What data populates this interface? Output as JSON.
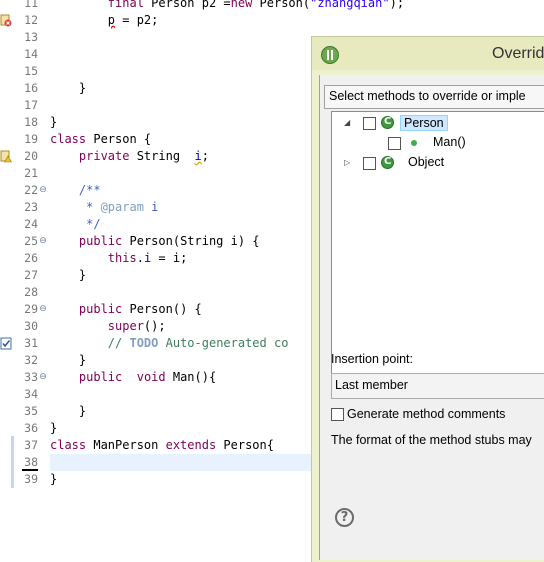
{
  "editor": {
    "lines": [
      {
        "num": "11",
        "code": "        final Person p2 =new Person(\"zhangqian\");"
      },
      {
        "num": "12",
        "code": "        p = p2;"
      },
      {
        "num": "13",
        "code": ""
      },
      {
        "num": "14",
        "code": ""
      },
      {
        "num": "15",
        "code": ""
      },
      {
        "num": "16",
        "code": "    }"
      },
      {
        "num": "17",
        "code": ""
      },
      {
        "num": "18",
        "code": "}"
      },
      {
        "num": "19",
        "code": "class Person {"
      },
      {
        "num": "20",
        "code": "    private String  i;"
      },
      {
        "num": "21",
        "code": ""
      },
      {
        "num": "22",
        "code": "    /**"
      },
      {
        "num": "23",
        "code": "     * @param i"
      },
      {
        "num": "24",
        "code": "     */"
      },
      {
        "num": "25",
        "code": "    public Person(String i) {"
      },
      {
        "num": "26",
        "code": "        this.i = i;"
      },
      {
        "num": "27",
        "code": "    }"
      },
      {
        "num": "28",
        "code": ""
      },
      {
        "num": "29",
        "code": "    public Person() {"
      },
      {
        "num": "30",
        "code": "        super();"
      },
      {
        "num": "31",
        "code": "        // TODO Auto-generated co"
      },
      {
        "num": "32",
        "code": "    }"
      },
      {
        "num": "33",
        "code": "    public  void Man(){"
      },
      {
        "num": "34",
        "code": ""
      },
      {
        "num": "35",
        "code": "    }"
      },
      {
        "num": "36",
        "code": "}"
      },
      {
        "num": "37",
        "code": "class ManPerson extends Person{"
      },
      {
        "num": "38",
        "code": ""
      },
      {
        "num": "39",
        "code": "}"
      }
    ]
  },
  "dialog": {
    "title": "Overrid",
    "select_label": "Select methods to override or imple",
    "tree": {
      "person_label": "Person",
      "man_label": "Man()",
      "object_label": "Object"
    },
    "insertion_label": "Insertion point:",
    "insertion_value": "Last member",
    "generate_comments_label": "Generate method comments",
    "stub_note": "The format of the method stubs may",
    "help_glyph": "?"
  }
}
